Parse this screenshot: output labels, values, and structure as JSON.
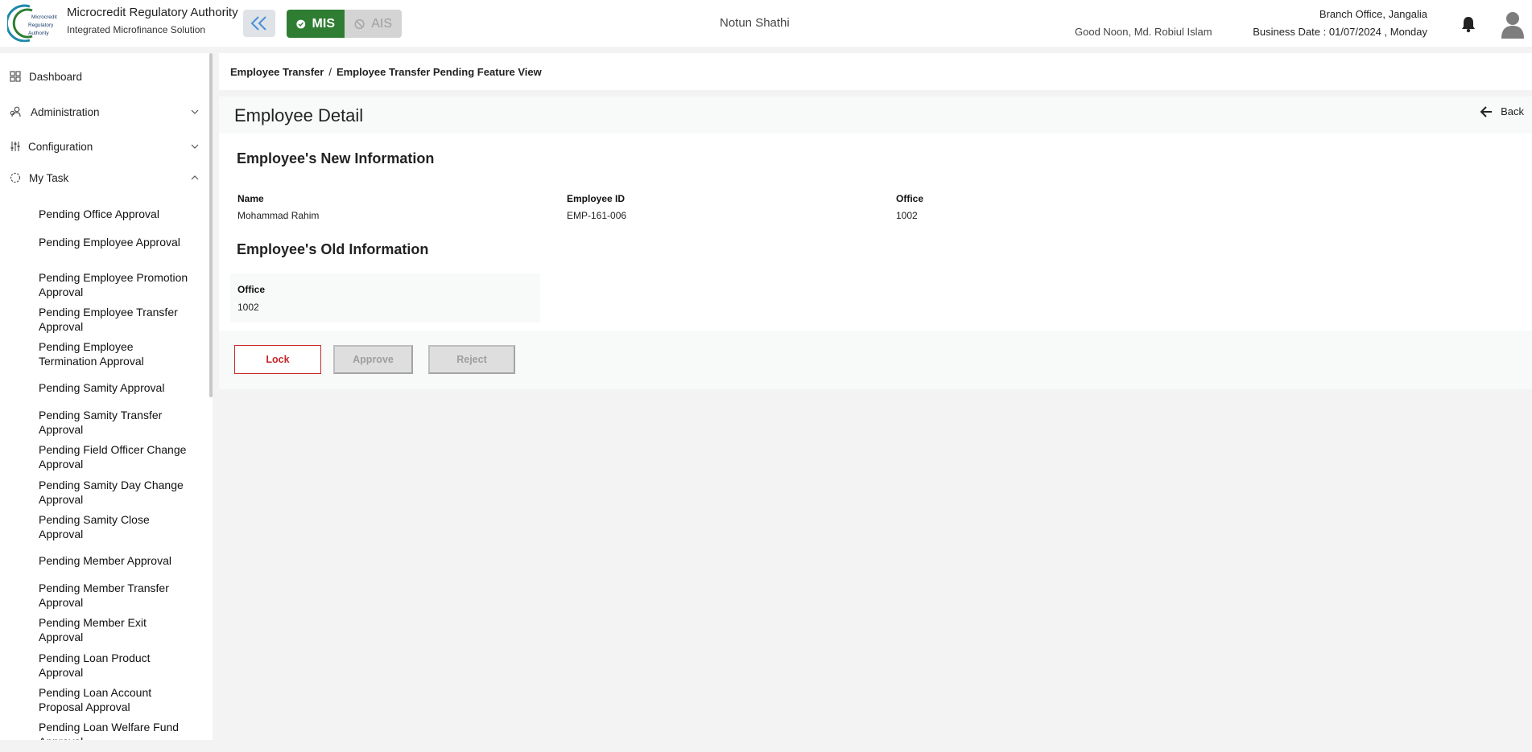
{
  "header": {
    "logo_text": "Microcredit Regulatory Authority",
    "app_title": "Microcredit Regulatory Authority",
    "app_subtitle": "Integrated Microfinance Solution",
    "modes": [
      {
        "label": "MIS",
        "active": true
      },
      {
        "label": "AIS",
        "active": false
      }
    ],
    "org_name": "Notun Shathi",
    "greeting": "Good Noon, Md. Robiul Islam",
    "branch": "Branch Office, Jangalia",
    "business_date": "Business Date : 01/07/2024 , Monday",
    "icons": [
      "double-chevron-left-icon",
      "check-circle-icon",
      "ban-icon",
      "bell-icon",
      "user-avatar-icon"
    ]
  },
  "sidebar": {
    "items": [
      {
        "label": "Dashboard",
        "icon": "grid-icon"
      },
      {
        "label": "Administration",
        "icon": "admin-icon",
        "expanded": false
      },
      {
        "label": "Configuration",
        "icon": "sliders-icon",
        "expanded": false
      },
      {
        "label": "My Task",
        "icon": "task-icon",
        "expanded": true
      }
    ],
    "tasks": [
      "Pending Office Approval",
      "Pending Employee Approval",
      "Pending Employee Promotion Approval",
      "Pending Employee Transfer Approval",
      "Pending Employee Termination Approval",
      "Pending Samity Approval",
      "Pending Samity Transfer Approval",
      "Pending Field Officer Change Approval",
      "Pending Samity Day Change Approval",
      "Pending Samity Close Approval",
      "Pending Member Approval",
      "Pending Member Transfer Approval",
      "Pending Member Exit Approval",
      "Pending Loan Product Approval",
      "Pending Loan Account Proposal Approval",
      "Pending Loan Welfare Fund Approval"
    ]
  },
  "breadcrumb": {
    "parent": "Employee Transfer",
    "separator": "/",
    "current": "Employee Transfer Pending Feature View"
  },
  "detail": {
    "title": "Employee Detail",
    "back_label": "Back",
    "new_info": {
      "title": "Employee's New Information",
      "fields": [
        {
          "label": "Name",
          "value": "Mohammad Rahim"
        },
        {
          "label": "Employee ID",
          "value": "EMP-161-006"
        },
        {
          "label": "Office",
          "value": "1002"
        }
      ]
    },
    "old_info": {
      "title": "Employee's Old Information",
      "fields": [
        {
          "label": "Office",
          "value": "1002"
        }
      ]
    },
    "actions": {
      "lock": "Lock",
      "approve": "Approve",
      "reject": "Reject"
    }
  },
  "colors": {
    "accent_green": "#2e7d32",
    "lock_red": "#c62828",
    "disabled_gray": "#dedede"
  }
}
